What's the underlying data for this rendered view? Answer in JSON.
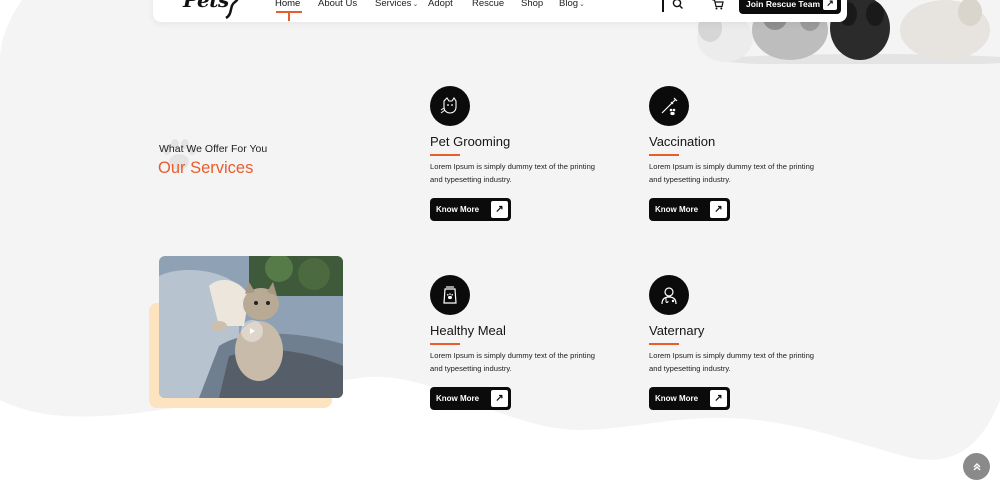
{
  "header": {
    "logo_text": "Pets",
    "nav": [
      {
        "label": "Home",
        "active": true
      },
      {
        "label": "About Us"
      },
      {
        "label": "Services",
        "has_dropdown": true
      },
      {
        "label": "Adopt"
      },
      {
        "label": "Rescue"
      },
      {
        "label": "Shop"
      },
      {
        "label": "Blog",
        "has_dropdown": true
      }
    ],
    "cta_label": "Join Rescue Team",
    "icons": [
      "search-icon",
      "cart-icon",
      "arrow-up-right-icon"
    ]
  },
  "services_section": {
    "subtitle": "What We Offer For You",
    "title": "Our Services",
    "video": {
      "icons": [
        "play-icon"
      ]
    },
    "items": [
      {
        "name": "Pet Grooming",
        "description": "Lorem Ipsum is simply dummy text of the printing and typesetting industry.",
        "button": "Know More",
        "icon": "grooming-icon"
      },
      {
        "name": "Vaccination",
        "description": "Lorem Ipsum is simply dummy text of the printing and typesetting industry.",
        "button": "Know More",
        "icon": "syringe-icon"
      },
      {
        "name": "Healthy Meal",
        "description": "Lorem Ipsum is simply dummy text of the printing and typesetting industry.",
        "button": "Know More",
        "icon": "food-bag-icon"
      },
      {
        "name": "Vaternary",
        "description": "Lorem Ipsum is simply dummy text of the printing and typesetting industry.",
        "button": "Know More",
        "icon": "vet-icon"
      }
    ]
  },
  "colors": {
    "accent": "#e85d2c",
    "dark": "#0b0b0b",
    "background": "#f4f4f4",
    "video_shadow": "#fde3bf"
  }
}
